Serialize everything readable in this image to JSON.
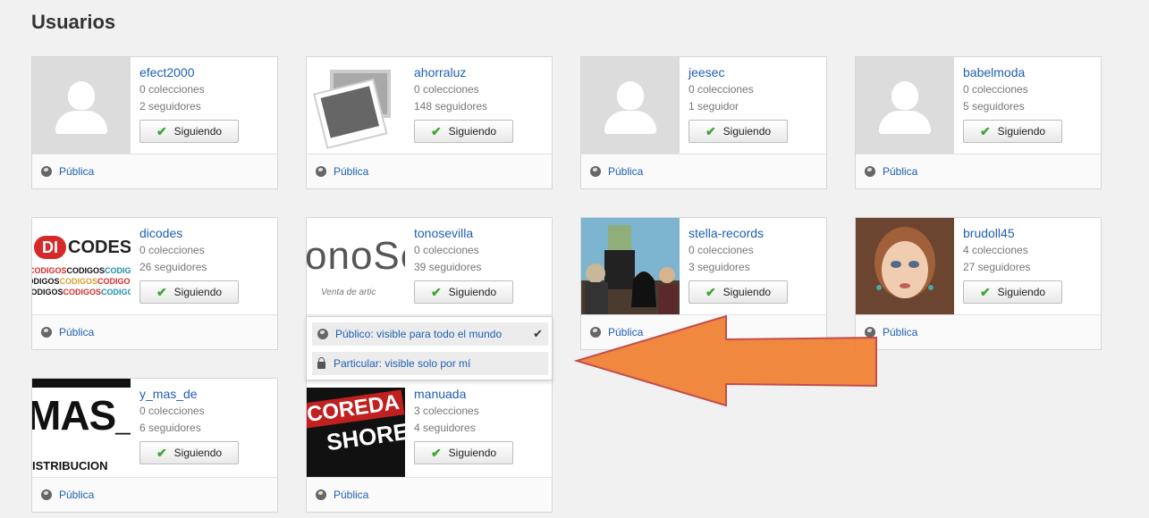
{
  "page": {
    "title": "Usuarios"
  },
  "labels": {
    "follow": "Siguiendo",
    "privacy": "Pública"
  },
  "users": [
    {
      "name": "efect2000",
      "collections": "0 colecciones",
      "followers": "2 seguidores"
    },
    {
      "name": "ahorraluz",
      "collections": "0 colecciones",
      "followers": "148 seguidores"
    },
    {
      "name": "jeesec",
      "collections": "0 colecciones",
      "followers": "1 seguidor"
    },
    {
      "name": "babelmoda",
      "collections": "0 colecciones",
      "followers": "5 seguidores"
    },
    {
      "name": "dicodes",
      "collections": "0 colecciones",
      "followers": "26 seguidores"
    },
    {
      "name": "tonosevilla",
      "collections": "0 colecciones",
      "followers": "39 seguidores"
    },
    {
      "name": "stella-records",
      "collections": "0 colecciones",
      "followers": "3 seguidores"
    },
    {
      "name": "brudoll45",
      "collections": "4 colecciones",
      "followers": "27 seguidores"
    },
    {
      "name": "y_mas_de",
      "collections": "0 colecciones",
      "followers": "6 seguidores"
    },
    {
      "name": "manuada",
      "collections": "3 colecciones",
      "followers": "4 seguidores"
    }
  ],
  "thumbs": {
    "dicodes": {
      "logo": "DI",
      "word": "CODES",
      "pattern": "CODIGOS"
    },
    "tonosevilla": {
      "text": "onoSe",
      "sub": "Venta de artic"
    },
    "y_mas_de": {
      "big": "MAS_",
      "small": "ISTRIBUCION"
    },
    "manuada": {
      "line1": "COREDA",
      "line2": "SHORE"
    }
  },
  "privacy_dropdown": {
    "options": [
      {
        "label": "Público: visible para todo el mundo",
        "selected": true,
        "icon": "globe-icon"
      },
      {
        "label": "Particular: visible solo por mí",
        "selected": false,
        "icon": "lock-icon"
      }
    ]
  },
  "colors": {
    "link": "#1f5fb3",
    "check": "#3ea432",
    "arrow": "#f08030"
  }
}
